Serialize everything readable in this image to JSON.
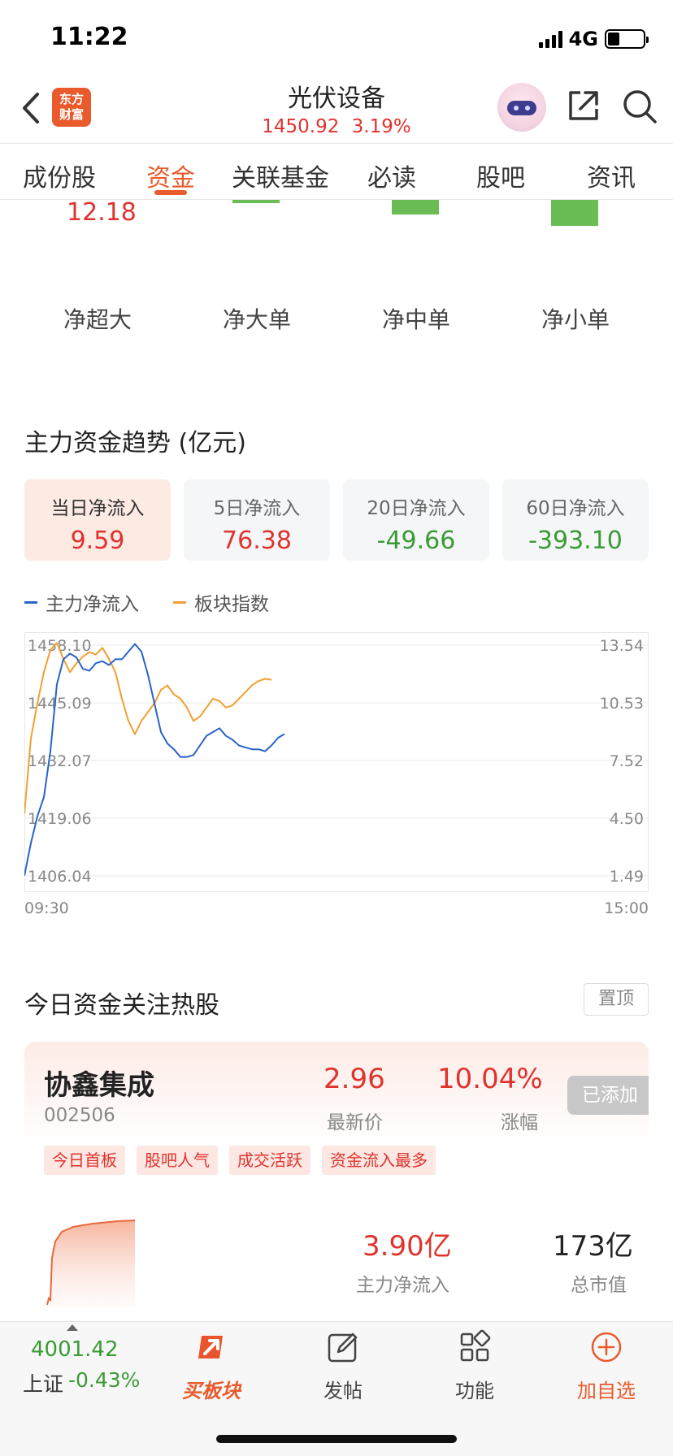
{
  "status": {
    "time": "11:22",
    "network": "4G"
  },
  "header": {
    "logo_line1": "东方",
    "logo_line2": "财富",
    "title": "光伏设备",
    "price": "1450.92",
    "change": "3.19%"
  },
  "tabs": [
    "成份股",
    "资金",
    "关联基金",
    "必读",
    "股吧",
    "资讯"
  ],
  "flow": {
    "top_value": "12.18",
    "labels": [
      "净超大",
      "净大单",
      "净中单",
      "净小单"
    ]
  },
  "trend": {
    "title": "主力资金趋势 (亿元)",
    "cards": [
      {
        "label": "当日净流入",
        "value": "9.59"
      },
      {
        "label": "5日净流入",
        "value": "76.38"
      },
      {
        "label": "20日净流入",
        "value": "-49.66"
      },
      {
        "label": "60日净流入",
        "value": "-393.10"
      }
    ],
    "legend": {
      "main": "主力净流入",
      "index": "板块指数"
    },
    "colors": {
      "main": "#2a62c9",
      "index": "#f0a030"
    }
  },
  "chart_data": {
    "type": "line",
    "left_ticks": [
      "1458.10",
      "1445.09",
      "1432.07",
      "1419.06",
      "1406.04"
    ],
    "right_ticks": [
      "13.54",
      "10.53",
      "7.52",
      "4.50",
      "1.49"
    ],
    "x_start": "09:30",
    "x_end": "15:00",
    "ylim_left": [
      1406.04,
      1458.1
    ],
    "ylim_right": [
      1.49,
      13.54
    ],
    "series": [
      {
        "name": "主力净流入",
        "axis": "right",
        "values": [
          1.5,
          3.2,
          4.6,
          5.6,
          8.0,
          11.5,
          12.8,
          13.1,
          12.9,
          12.3,
          12.2,
          12.6,
          12.7,
          12.5,
          12.8,
          12.8,
          13.2,
          13.6,
          13.2,
          12.0,
          10.5,
          9.0,
          8.4,
          8.1,
          7.7,
          7.7,
          7.8,
          8.3,
          8.8,
          9.0,
          9.2,
          8.8,
          8.6,
          8.3,
          8.2,
          8.1,
          8.1,
          8.0,
          8.3,
          8.7,
          8.9
        ]
      },
      {
        "name": "板块指数",
        "axis": "left",
        "values": [
          1420.0,
          1437.0,
          1445.0,
          1452.0,
          1457.0,
          1458.6,
          1455.0,
          1452.0,
          1454.0,
          1455.5,
          1456.5,
          1456.0,
          1457.5,
          1455.0,
          1452.0,
          1446.0,
          1441.0,
          1438.0,
          1441.0,
          1443.0,
          1445.0,
          1448.0,
          1449.0,
          1447.0,
          1446.0,
          1444.0,
          1441.0,
          1442.0,
          1444.0,
          1446.0,
          1445.5,
          1444.0,
          1444.5,
          1446.0,
          1447.5,
          1449.0,
          1450.0,
          1450.5,
          1450.3
        ]
      }
    ]
  },
  "hot": {
    "title": "今日资金关注热股",
    "pin_label": "置顶",
    "stock": {
      "name": "协鑫集成",
      "code": "002506",
      "price": "2.96",
      "price_label": "最新价",
      "change": "10.04%",
      "change_label": "涨幅",
      "added_label": "已添加",
      "tags": [
        "今日首板",
        "股吧人气",
        "成交活跃",
        "资金流入最多"
      ],
      "flow_value": "3.90亿",
      "flow_label": "主力净流入",
      "cap_value": "173亿",
      "cap_label": "总市值"
    }
  },
  "bottom": {
    "index_value": "4001.42",
    "index_name": "上证",
    "index_change": "-0.43%",
    "nav": [
      "买板块",
      "发帖",
      "功能",
      "加自选"
    ]
  }
}
